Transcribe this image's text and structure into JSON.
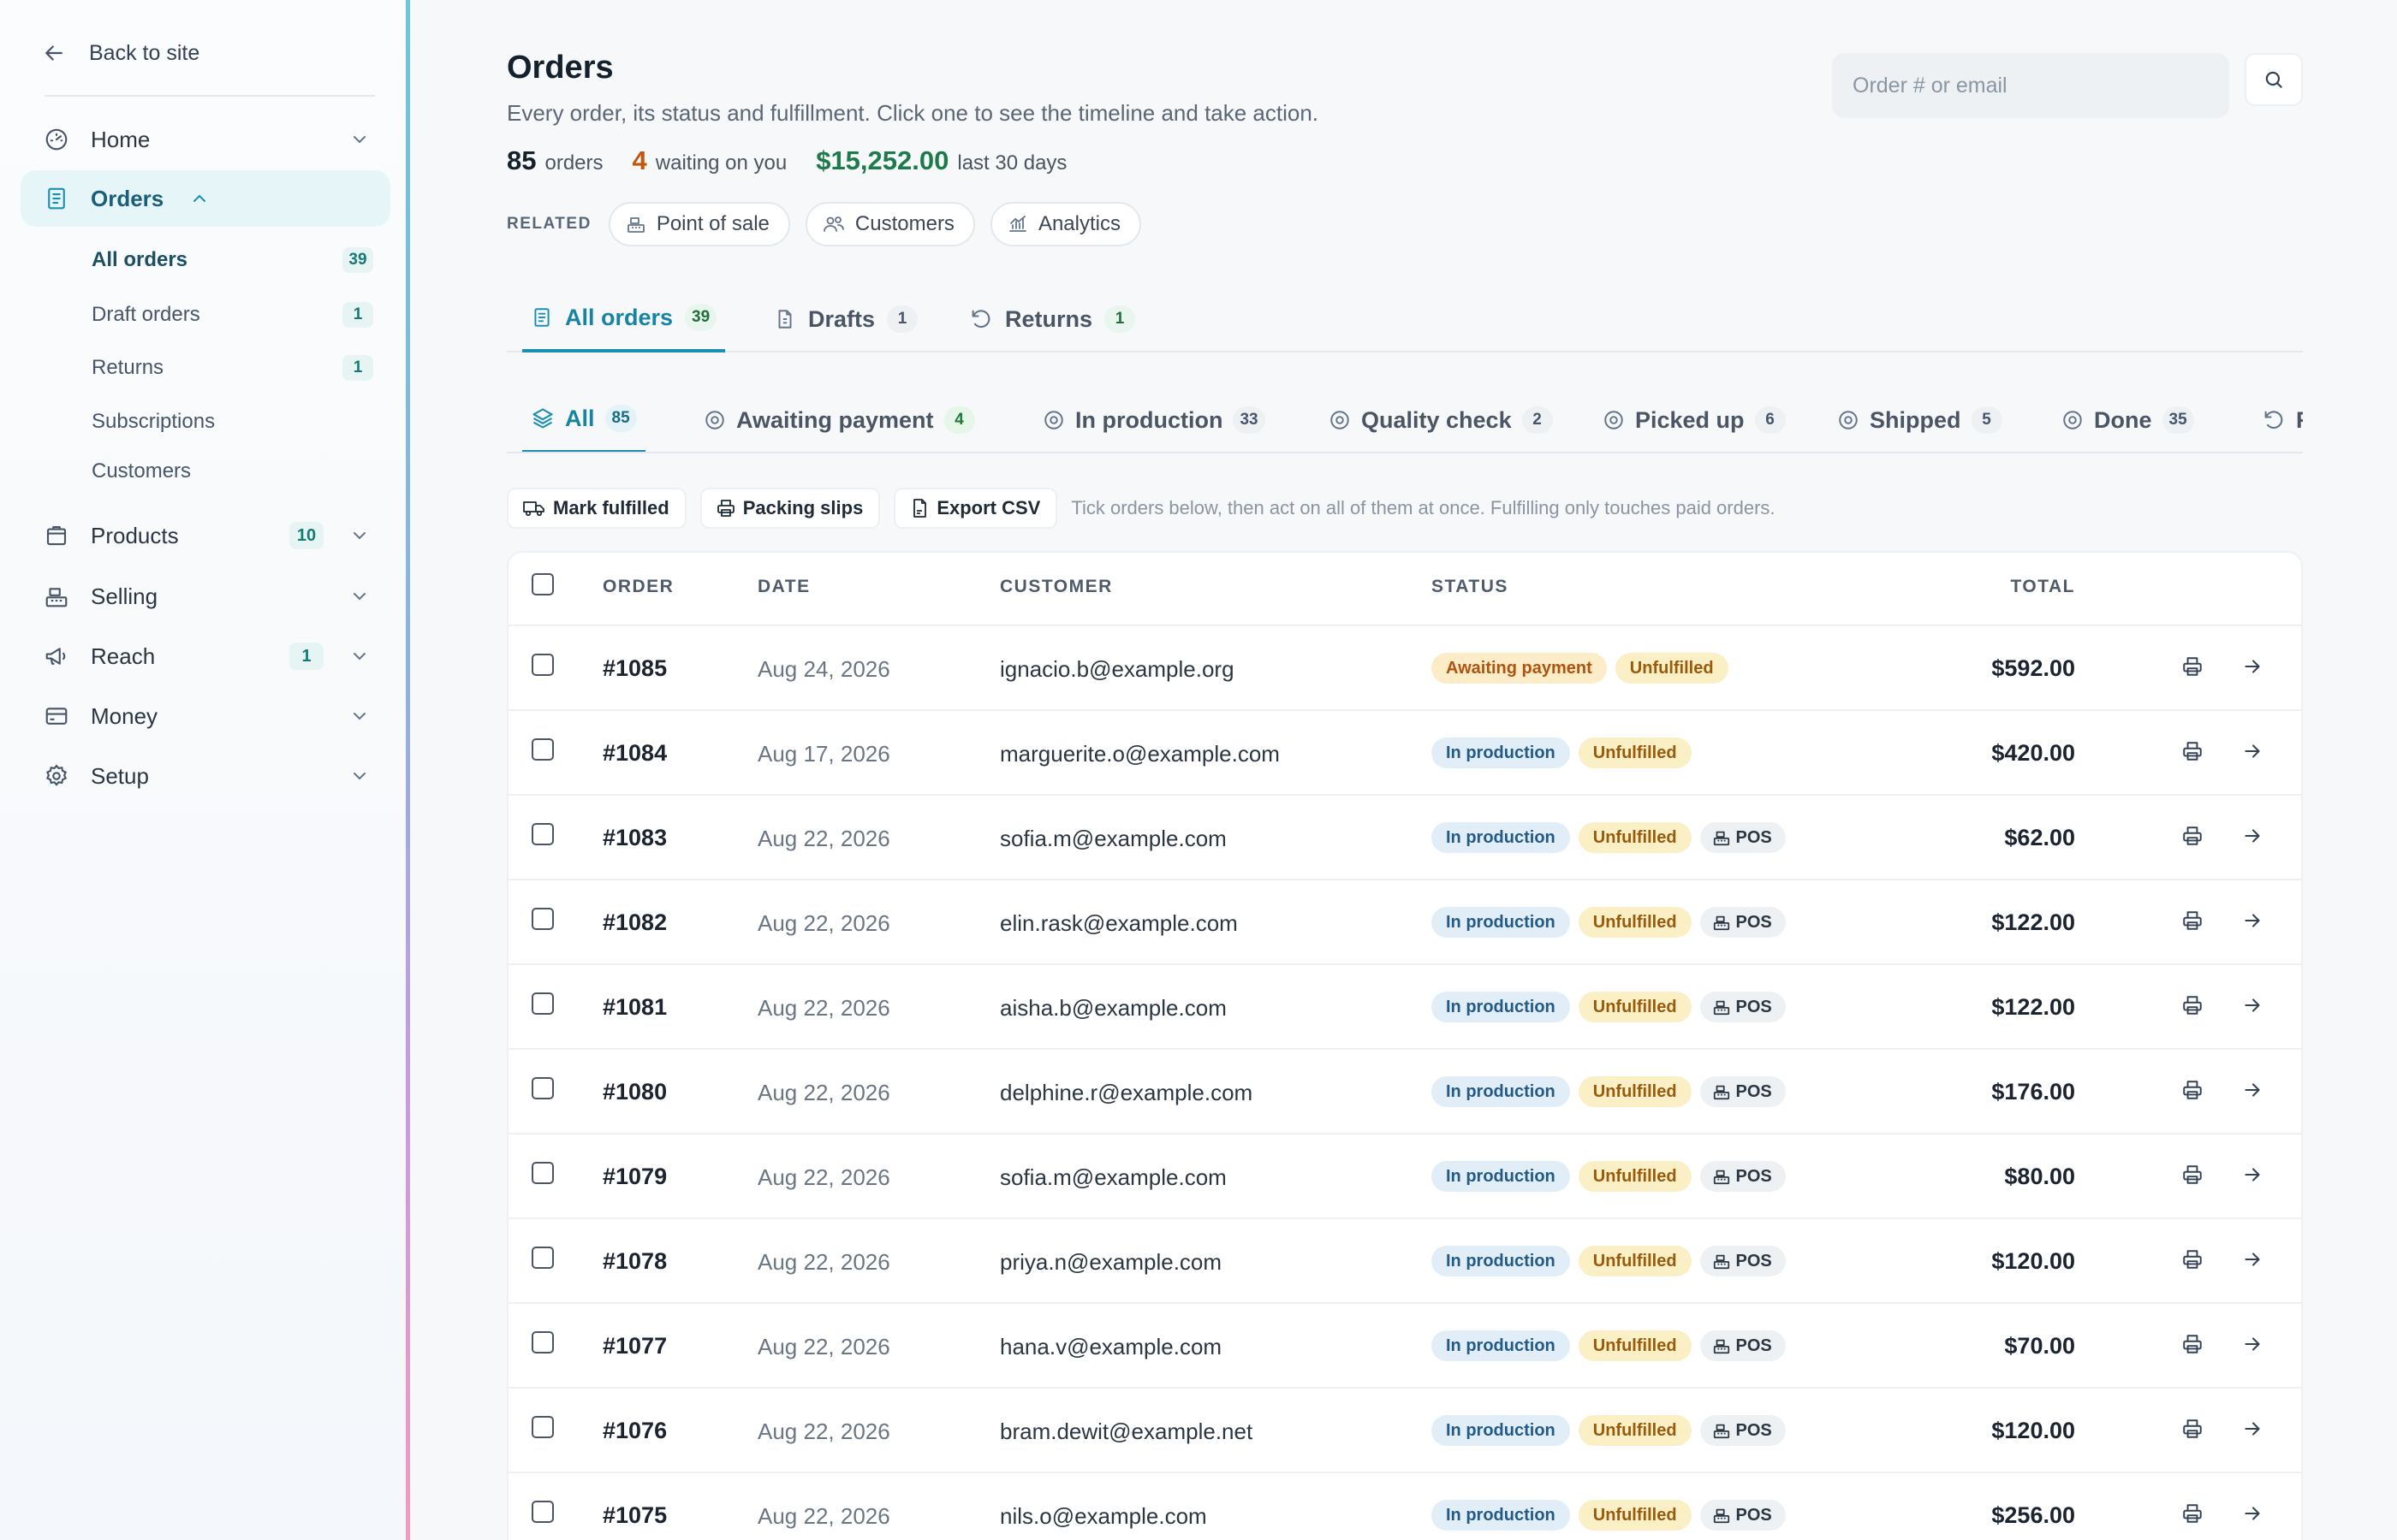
{
  "sidebar": {
    "back_label": "Back to site",
    "nav": [
      {
        "label": "Home"
      },
      {
        "label": "Orders"
      },
      {
        "label": "Products",
        "count": "10"
      },
      {
        "label": "Selling"
      },
      {
        "label": "Reach",
        "count": "1"
      },
      {
        "label": "Money"
      },
      {
        "label": "Setup"
      }
    ],
    "orders_sub": [
      {
        "label": "All orders",
        "count": "39"
      },
      {
        "label": "Draft orders",
        "count": "1"
      },
      {
        "label": "Returns",
        "count": "1"
      },
      {
        "label": "Subscriptions"
      },
      {
        "label": "Customers"
      }
    ]
  },
  "header": {
    "title": "Orders",
    "subtitle": "Every order, its status and fulfillment. Click one to see the timeline and take action.",
    "stats": {
      "orders_num": "85",
      "orders_label": "orders",
      "waiting_num": "4",
      "waiting_label": "waiting on you",
      "revenue": "$15,252.00",
      "revenue_label": "last 30 days"
    },
    "related_label": "RELATED",
    "related": [
      "Point of sale",
      "Customers",
      "Analytics"
    ],
    "search_placeholder": "Order # or email"
  },
  "colors": {
    "accent": "#1b8fb3",
    "revenue": "#1d7a4a",
    "waiting": "#c2570c"
  },
  "primary_tabs": [
    {
      "label": "All orders",
      "count": "39"
    },
    {
      "label": "Drafts",
      "count": "1"
    },
    {
      "label": "Returns",
      "count": "1"
    }
  ],
  "status_tabs": [
    {
      "label": "All",
      "count": "85"
    },
    {
      "label": "Awaiting payment",
      "count": "4"
    },
    {
      "label": "In production",
      "count": "33"
    },
    {
      "label": "Quality check",
      "count": "2"
    },
    {
      "label": "Picked up",
      "count": "6"
    },
    {
      "label": "Shipped",
      "count": "5"
    },
    {
      "label": "Done",
      "count": "35"
    },
    {
      "label": "R"
    }
  ],
  "bulk": {
    "mark_fulfilled": "Mark fulfilled",
    "packing_slips": "Packing slips",
    "export_csv": "Export CSV",
    "hint": "Tick orders below, then act on all of them at once. Fulfilling only touches paid orders."
  },
  "table": {
    "headers": {
      "order": "ORDER",
      "date": "DATE",
      "customer": "CUSTOMER",
      "status": "STATUS",
      "total": "TOTAL"
    },
    "rows": [
      {
        "order": "#1085",
        "date": "Aug 24, 2026",
        "customer": "ignacio.b@example.org",
        "status": "Awaiting payment",
        "fulfillment": "Unfulfilled",
        "pos": "",
        "total": "$592.00"
      },
      {
        "order": "#1084",
        "date": "Aug 17, 2026",
        "customer": "marguerite.o@example.com",
        "status": "In production",
        "fulfillment": "Unfulfilled",
        "pos": "",
        "total": "$420.00"
      },
      {
        "order": "#1083",
        "date": "Aug 22, 2026",
        "customer": "sofia.m@example.com",
        "status": "In production",
        "fulfillment": "Unfulfilled",
        "pos": "POS",
        "total": "$62.00"
      },
      {
        "order": "#1082",
        "date": "Aug 22, 2026",
        "customer": "elin.rask@example.com",
        "status": "In production",
        "fulfillment": "Unfulfilled",
        "pos": "POS",
        "total": "$122.00"
      },
      {
        "order": "#1081",
        "date": "Aug 22, 2026",
        "customer": "aisha.b@example.com",
        "status": "In production",
        "fulfillment": "Unfulfilled",
        "pos": "POS",
        "total": "$122.00"
      },
      {
        "order": "#1080",
        "date": "Aug 22, 2026",
        "customer": "delphine.r@example.com",
        "status": "In production",
        "fulfillment": "Unfulfilled",
        "pos": "POS",
        "total": "$176.00"
      },
      {
        "order": "#1079",
        "date": "Aug 22, 2026",
        "customer": "sofia.m@example.com",
        "status": "In production",
        "fulfillment": "Unfulfilled",
        "pos": "POS",
        "total": "$80.00"
      },
      {
        "order": "#1078",
        "date": "Aug 22, 2026",
        "customer": "priya.n@example.com",
        "status": "In production",
        "fulfillment": "Unfulfilled",
        "pos": "POS",
        "total": "$120.00"
      },
      {
        "order": "#1077",
        "date": "Aug 22, 2026",
        "customer": "hana.v@example.com",
        "status": "In production",
        "fulfillment": "Unfulfilled",
        "pos": "POS",
        "total": "$70.00"
      },
      {
        "order": "#1076",
        "date": "Aug 22, 2026",
        "customer": "bram.dewit@example.net",
        "status": "In production",
        "fulfillment": "Unfulfilled",
        "pos": "POS",
        "total": "$120.00"
      },
      {
        "order": "#1075",
        "date": "Aug 22, 2026",
        "customer": "nils.o@example.com",
        "status": "In production",
        "fulfillment": "Unfulfilled",
        "pos": "POS",
        "total": "$256.00"
      }
    ]
  }
}
